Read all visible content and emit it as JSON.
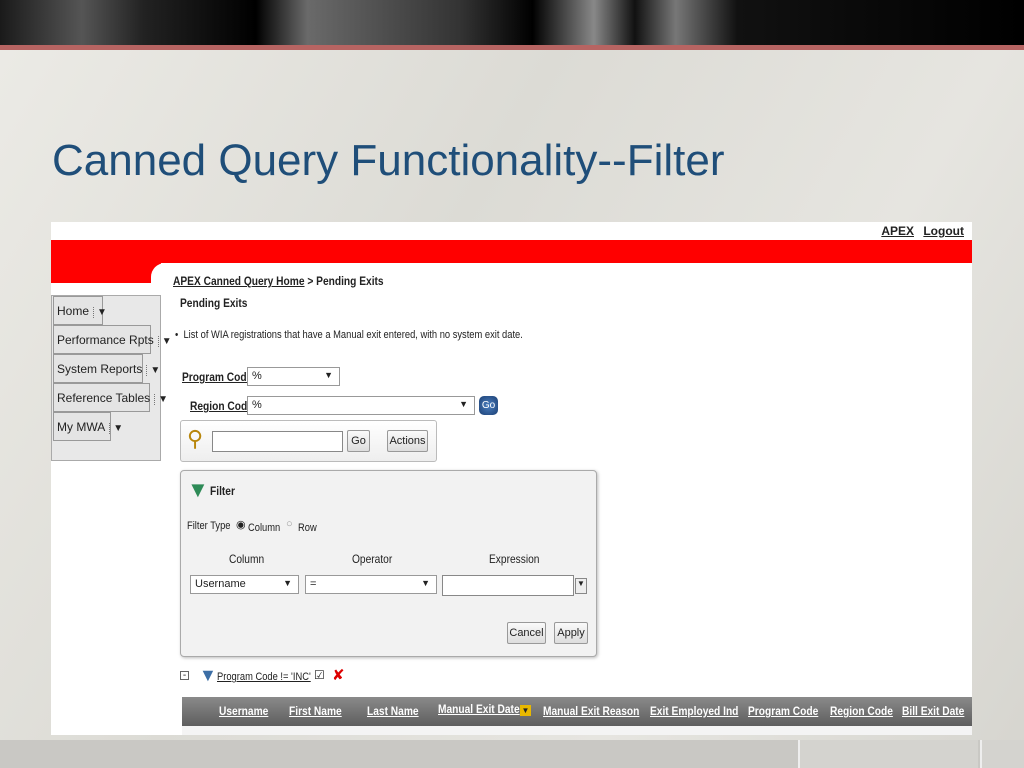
{
  "slide": {
    "title": "Canned Query Functionality--Filter"
  },
  "app": {
    "top_links": [
      "APEX",
      "Logout"
    ],
    "breadcrumb": {
      "home": "APEX Canned Query Home",
      "separator": " > ",
      "current": "Pending Exits"
    },
    "page_heading": "Pending Exits",
    "description": "List of WIA registrations that have a Manual exit entered, with no system exit date.",
    "nav": [
      {
        "label": "Home"
      },
      {
        "label": "Performance Rpts"
      },
      {
        "label": "System Reports"
      },
      {
        "label": "Reference Tables"
      },
      {
        "label": "My MWA"
      }
    ],
    "program_code": {
      "label": "Program Code",
      "value": "%"
    },
    "region_code": {
      "label": "Region Code",
      "value": "%"
    },
    "go_label": "Go",
    "search": {
      "value": "",
      "go": "Go",
      "actions": "Actions"
    },
    "filter": {
      "title": "Filter",
      "type_label": "Filter Type",
      "type_options": [
        "Column",
        "Row"
      ],
      "selected_type": "Column",
      "col_header": "Column",
      "op_header": "Operator",
      "expr_header": "Expression",
      "column_value": "Username",
      "operator_value": "=",
      "expression_value": "",
      "cancel": "Cancel",
      "apply": "Apply"
    },
    "active_filter": "Program Code != 'INC'",
    "columns": [
      "Username",
      "First Name",
      "Last Name",
      "Manual Exit Date",
      "Manual Exit Reason",
      "Exit Employed Ind",
      "Program Code",
      "Region Code",
      "Bill Exit Date"
    ]
  }
}
